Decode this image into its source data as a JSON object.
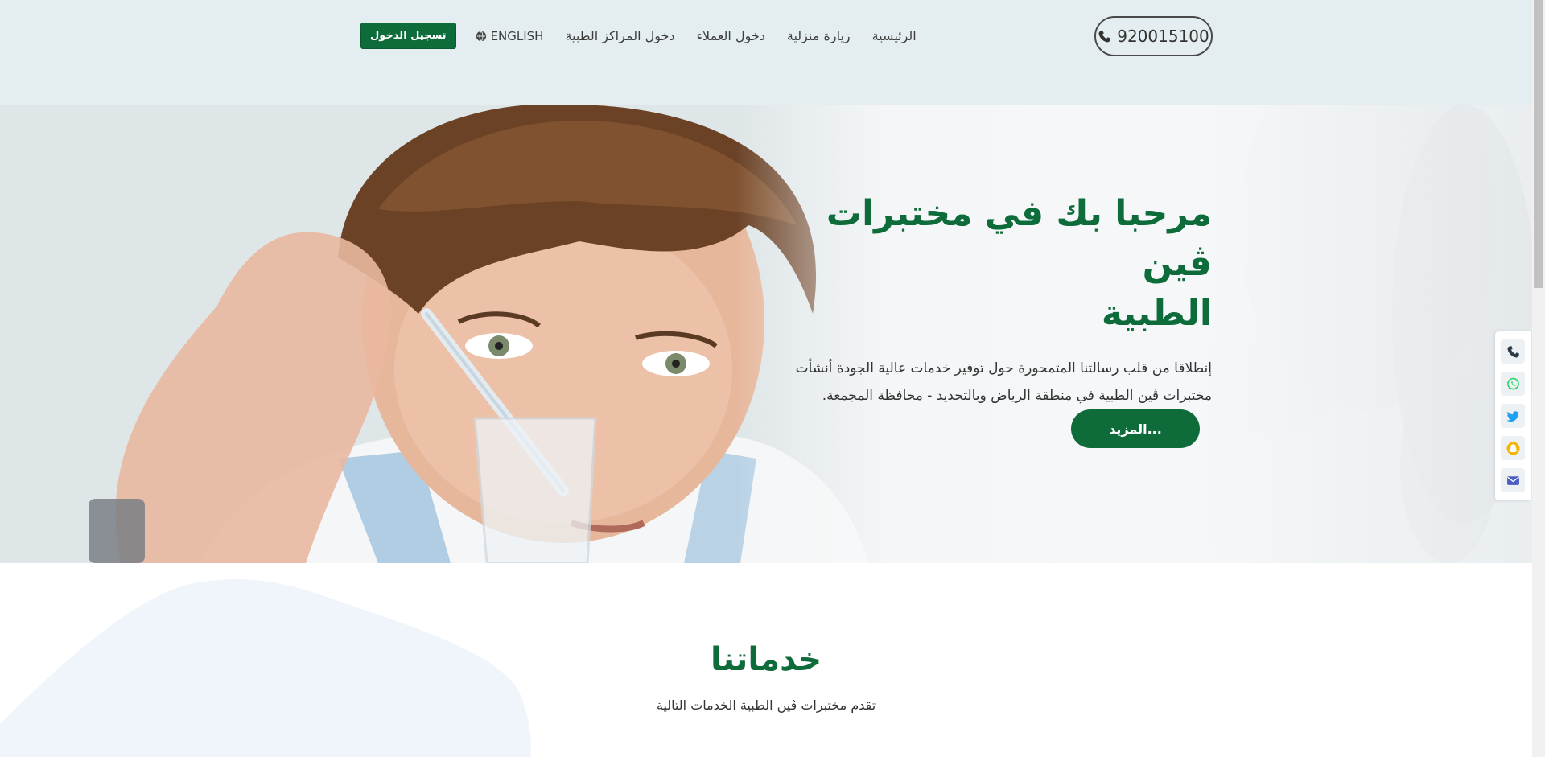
{
  "header": {
    "phone_number": "920015100",
    "nav": {
      "home": "الرئيسية",
      "home_visit": "زيارة منزلية",
      "client_login": "دخول العملاء",
      "centers_login": "دخول المراكز الطبية",
      "language": "ENGLISH",
      "login_button": "تسجيل الدخول"
    }
  },
  "hero": {
    "title_line1": "مرحبا بك في مختبرات ڤين",
    "title_line2": "الطبية",
    "description": "إنطلاقا من قلب رسالتنا المتمحورة حول توفير خدمات عالية الجودة أنشأت مختبرات ڤين الطبية في منطقة الرياض وبالتحديد - محافظة المجمعة.",
    "more_button": "المزيد..."
  },
  "social_bar": {
    "items": [
      "phone-icon",
      "whatsapp-icon",
      "twitter-icon",
      "snapchat-icon",
      "email-icon"
    ]
  },
  "services": {
    "title": "خدماتنا",
    "subtitle": "تقدم مختبرات ڤين الطبية الخدمات التالية"
  },
  "colors": {
    "brand_green": "#0e6b3a",
    "header_bg": "#e4eef0",
    "twitter": "#1da1f2",
    "whatsapp": "#25d366",
    "snapchat": "#f5b400",
    "email": "#4b5ec4"
  }
}
